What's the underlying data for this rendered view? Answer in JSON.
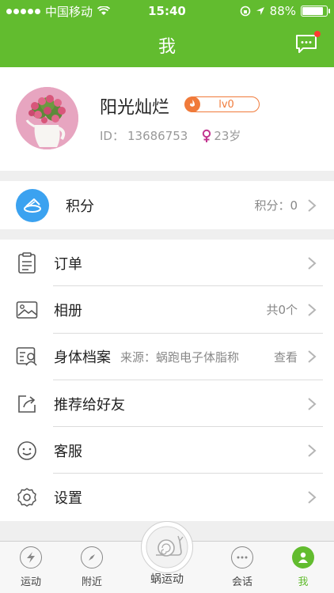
{
  "status": {
    "carrier": "中国移动",
    "time": "15:40",
    "battery": "88%",
    "battery_level": 0.88
  },
  "header": {
    "title": "我",
    "message_icon": "chat-bubble-icon",
    "has_unread": true
  },
  "profile": {
    "name": "阳光灿烂",
    "level": "lv0",
    "id_label": "ID：",
    "id_value": "13686753",
    "gender": "female",
    "age": "23岁"
  },
  "points": {
    "label": "积分",
    "value_text": "积分：0"
  },
  "menu": {
    "items": [
      {
        "label": "订单",
        "icon": "clipboard-icon",
        "right": ""
      },
      {
        "label": "相册",
        "icon": "picture-icon",
        "right": "共0个"
      },
      {
        "label": "身体档案",
        "icon": "profile-card-icon",
        "source": "来源：蜗跑电子体脂称",
        "right": "查看"
      },
      {
        "label": "推荐给好友",
        "icon": "share-icon",
        "right": ""
      },
      {
        "label": "客服",
        "icon": "smile-icon",
        "right": ""
      },
      {
        "label": "设置",
        "icon": "gear-icon",
        "right": ""
      }
    ]
  },
  "tabs": {
    "items": [
      {
        "label": "运动",
        "icon": "lightning-icon"
      },
      {
        "label": "附近",
        "icon": "compass-icon"
      },
      {
        "label": "蜗运动",
        "icon": "snail-icon"
      },
      {
        "label": "会话",
        "icon": "chat-icon"
      },
      {
        "label": "我",
        "icon": "user-icon",
        "active": true
      }
    ]
  },
  "colors": {
    "brand_green": "#62bc2f",
    "points_blue": "#3ba2f0",
    "level_orange": "#f07a3a",
    "gender_pink": "#c2348f"
  }
}
